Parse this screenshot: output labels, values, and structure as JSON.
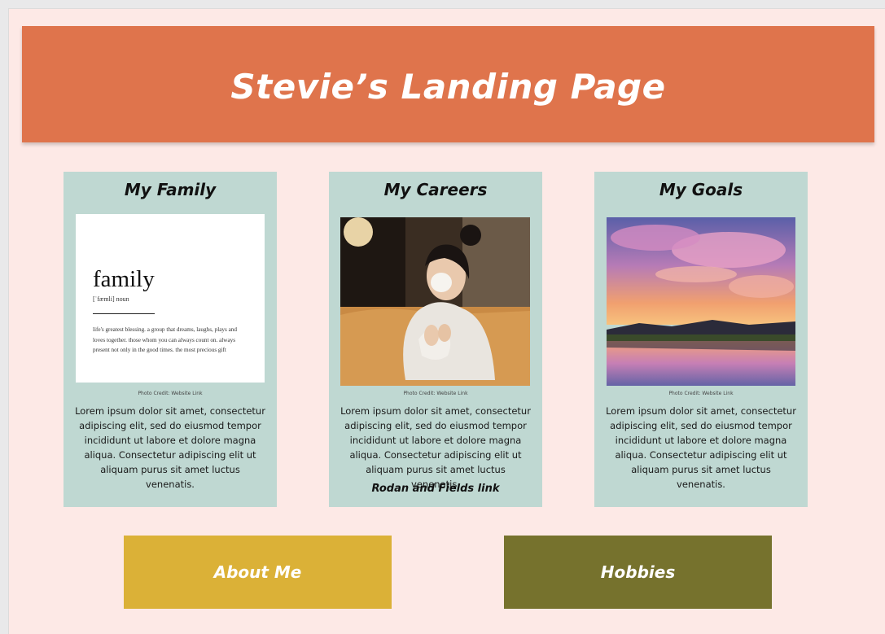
{
  "header": {
    "title": "Stevie’s Landing Page"
  },
  "cards": [
    {
      "title": "My Family",
      "image": {
        "word": "family",
        "pronunciation": "[ˈfæmli] noun",
        "definition": "life's greatest blessing. a group that dreams, laughs, plays and loves together. those whom you can always count on. always present not only in the good times. the most precious gift"
      },
      "credit": "Photo Credit: Website Link",
      "text": "Lorem ipsum dolor sit amet, consectetur adipiscing elit, sed do eiusmod tempor incididunt ut labore et dolore magna aliqua. Consectetur adipiscing elit ut aliquam purus sit amet luctus venenatis."
    },
    {
      "title": "My Careers",
      "credit": "Photo Credit: Website Link",
      "text": "Lorem ipsum dolor sit amet, consectetur adipiscing elit, sed do eiusmod tempor incididunt ut labore et dolore magna aliqua. Consectetur adipiscing elit ut aliquam purus sit amet luctus venenatis.",
      "link": "Rodan and Fields link"
    },
    {
      "title": "My Goals",
      "credit": "Photo Credit: Website Link",
      "text": "Lorem ipsum dolor sit amet, consectetur adipiscing elit, sed do eiusmod tempor incididunt ut labore et dolore magna aliqua. Consectetur adipiscing elit ut aliquam purus sit amet luctus venenatis."
    }
  ],
  "buttons": {
    "about": {
      "label": "About Me",
      "color": "#dbb137"
    },
    "hobbies": {
      "label": "Hobbies",
      "color": "#76722d"
    }
  },
  "colors": {
    "header": "#df744c",
    "background": "#fde9e6",
    "card": "#bfd8d2"
  }
}
